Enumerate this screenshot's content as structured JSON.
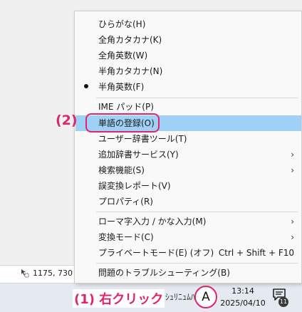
{
  "menu": {
    "items": [
      {
        "label": "ひらがな(H)"
      },
      {
        "label": "全角カタカナ(K)"
      },
      {
        "label": "全角英数(W)"
      },
      {
        "label": "半角カタカナ(N)"
      },
      {
        "label": "半角英数(F)",
        "selected": true
      },
      {
        "label": "IME パッド(P)"
      },
      {
        "label": "単語の登録(O)",
        "highlighted": true
      },
      {
        "label": "ユーザー辞書ツール(T)"
      },
      {
        "label": "追加辞書サービス(Y)",
        "submenu": true
      },
      {
        "label": "検索機能(S)",
        "submenu": true
      },
      {
        "label": "誤変換レポート(V)"
      },
      {
        "label": "プロパティ(R)"
      },
      {
        "label": "ローマ字入力 / かな入力(M)",
        "submenu": true
      },
      {
        "label": "変換モード(C)",
        "submenu": true
      },
      {
        "label": "プライベートモード(E) (オフ)",
        "shortcut": "Ctrl + Shift + F10",
        "submenu": true
      },
      {
        "label": "問題のトラブルシューティング(B)"
      }
    ],
    "submenu_arrow": "›"
  },
  "status_bar": {
    "coordinates": "1175, 730"
  },
  "taskbar": {
    "ime_indicator": "A",
    "time": "13:14",
    "date": "2025/04/10",
    "notification_count": "11",
    "hidden_tray_text": "ｼｭﾘﾆｭﾑﾊﾞ"
  },
  "annotations": {
    "step1": "(1) 右クリック",
    "step2": "(2)"
  },
  "colors": {
    "accent": "#e0246e",
    "highlight": "#9fd1f6"
  }
}
